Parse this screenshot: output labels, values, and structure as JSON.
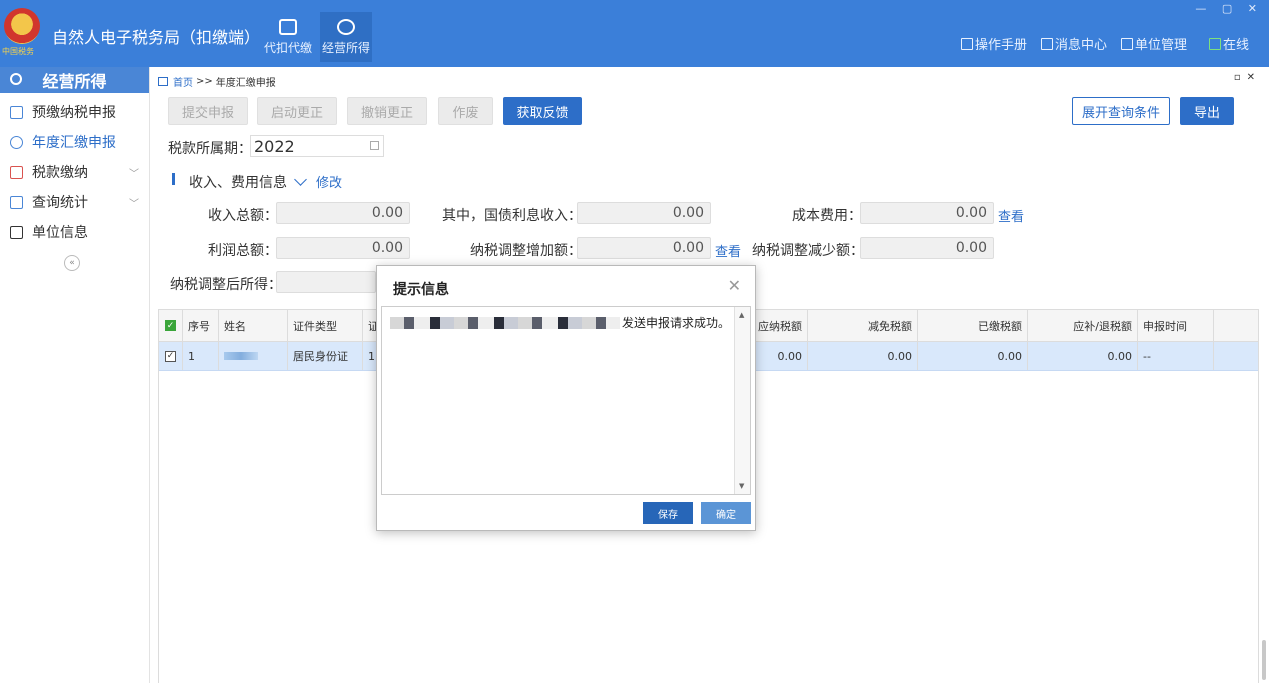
{
  "app": {
    "title": "自然人电子税务局（扣缴端）",
    "logo_text": "中国税务",
    "top_nav": [
      {
        "label": "代扣代缴",
        "icon": "wallet-icon"
      },
      {
        "label": "经营所得",
        "icon": "coins-icon",
        "active": true
      }
    ],
    "header_links": [
      {
        "label": "操作手册",
        "icon": "manual-icon"
      },
      {
        "label": "消息中心",
        "icon": "mail-icon"
      },
      {
        "label": "单位管理",
        "icon": "building-icon"
      },
      {
        "label": "在线",
        "icon": "online-status-icon"
      }
    ]
  },
  "sidebar": {
    "title": "经营所得",
    "items": [
      {
        "label": "预缴纳税申报",
        "icon": "prepay-icon"
      },
      {
        "label": "年度汇缴申报",
        "icon": "annual-icon",
        "active": true
      },
      {
        "label": "税款缴纳",
        "icon": "payment-icon",
        "expandable": true
      },
      {
        "label": "查询统计",
        "icon": "stats-icon",
        "expandable": true
      },
      {
        "label": "单位信息",
        "icon": "company-info-icon"
      }
    ],
    "collapse": "«"
  },
  "breadcrumb": {
    "home": "首页",
    "sep": ">>",
    "current": "年度汇缴申报"
  },
  "toolbar": {
    "submit": "提交申报",
    "start_correct": "启动更正",
    "cancel_correct": "撤销更正",
    "void": "作废",
    "get_feedback": "获取反馈",
    "expand_query": "展开查询条件",
    "export": "导出"
  },
  "period": {
    "label": "税款所属期：",
    "value": "2022"
  },
  "section": {
    "title": "收入、费用信息",
    "edit": "修改"
  },
  "income": {
    "total_income_label": "收入总额：",
    "total_income": "0.00",
    "bond_interest_label": "其中，国债利息收入：",
    "bond_interest": "0.00",
    "cost_label": "成本费用：",
    "cost": "0.00",
    "view": "查看",
    "profit_label": "利润总额：",
    "profit": "0.00",
    "adjust_add_label": "纳税调整增加额：",
    "adjust_add": "0.00",
    "adjust_sub_label": "纳税调整减少额：",
    "adjust_sub": "0.00",
    "adjusted_label": "纳税调整后所得："
  },
  "table": {
    "headers": [
      "序号",
      "姓名",
      "证件类型",
      "证",
      "应纳税额",
      "减免税额",
      "已缴税额",
      "应补/退税额",
      "申报时间"
    ],
    "rows": [
      {
        "index": "1",
        "id_type": "居民身份证",
        "id_no": "1",
        "tax_payable": "0.00",
        "tax_relief": "0.00",
        "tax_paid": "0.00",
        "tax_due": "0.00",
        "time": "--"
      }
    ]
  },
  "dialog": {
    "title": "提示信息",
    "message": "发送申报请求成功。",
    "save": "保存",
    "ok": "确定"
  }
}
